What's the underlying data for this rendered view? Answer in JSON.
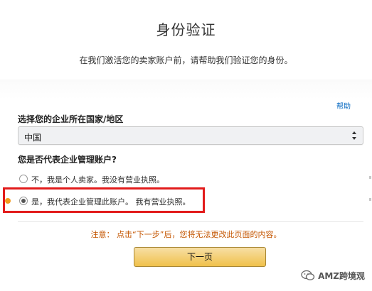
{
  "header": {
    "title": "身份验证",
    "subtitle": "在我们激活您的卖家账户前，请帮助我们验证您的身份。"
  },
  "help": {
    "label": "帮助"
  },
  "country": {
    "label": "选择您的企业所在国家/地区",
    "selected": "中国"
  },
  "business_question": {
    "label": "您是否代表企业管理账户?",
    "options": [
      {
        "label": "不，我是个人卖家。我没有营业执照。",
        "checked": false
      },
      {
        "label": "是，我代表企业管理此账户。 我有营业执照。",
        "checked": true
      }
    ]
  },
  "notice": "注意： 点击“下一步”后，您将无法更改此页面的内容。",
  "next_button": {
    "label": "下一页"
  },
  "watermark": {
    "text": "AMZ跨境观"
  },
  "colors": {
    "highlight": "#e21b1b",
    "button": "#f0c14b",
    "notice": "#c45500",
    "link": "#0066c0",
    "dot": "#f29b1f"
  }
}
